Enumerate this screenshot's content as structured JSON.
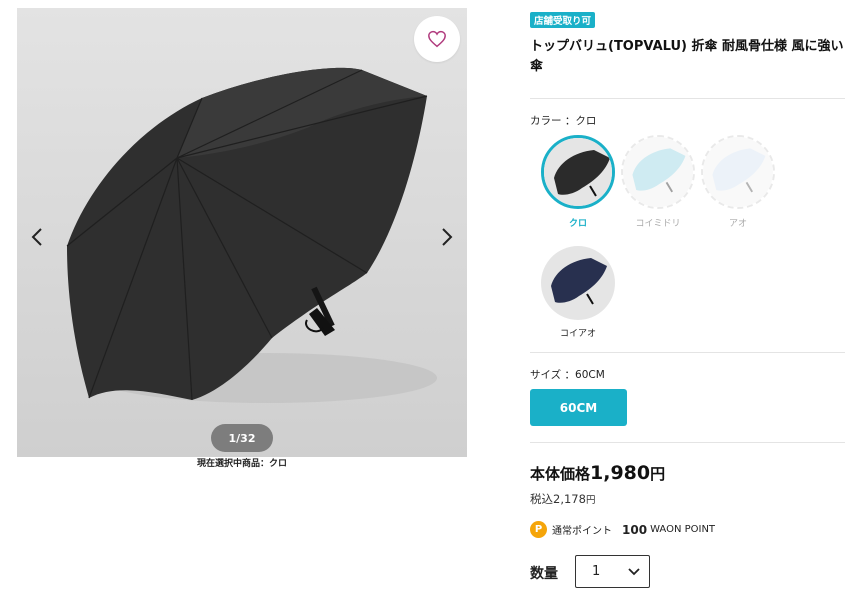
{
  "gallery": {
    "counter": "1/32",
    "selected_caption": "現在選択中商品：クロ"
  },
  "product": {
    "badge": "店舗受取り可",
    "title": "トップバリュ(TOPVALU) 折傘 耐風骨仕様 風に強い傘"
  },
  "color": {
    "label": "カラー ：クロ",
    "options": [
      {
        "name": "クロ",
        "color": "#2b2b2b",
        "selected": true
      },
      {
        "name": "コイミドリ",
        "color": "#a8dbe8",
        "selected": false
      },
      {
        "name": "アオ",
        "color": "#dde9f5",
        "selected": false
      },
      {
        "name": "コイアオ",
        "color": "#28304f",
        "selected": false
      }
    ]
  },
  "size": {
    "label": "サイズ ：60CM",
    "option": "60CM"
  },
  "price": {
    "label": "本体価格",
    "value": "1,980",
    "unit": "円",
    "tax_label": "税込",
    "tax_value": "2,178",
    "tax_unit": "円"
  },
  "points": {
    "icon_letter": "P",
    "label": "通常ポイント",
    "value": "100",
    "unit": "WAON POINT"
  },
  "quantity": {
    "label": "数量",
    "value": "1"
  },
  "colors": {
    "accent": "#1ab0c8",
    "point": "#f5a50a"
  }
}
